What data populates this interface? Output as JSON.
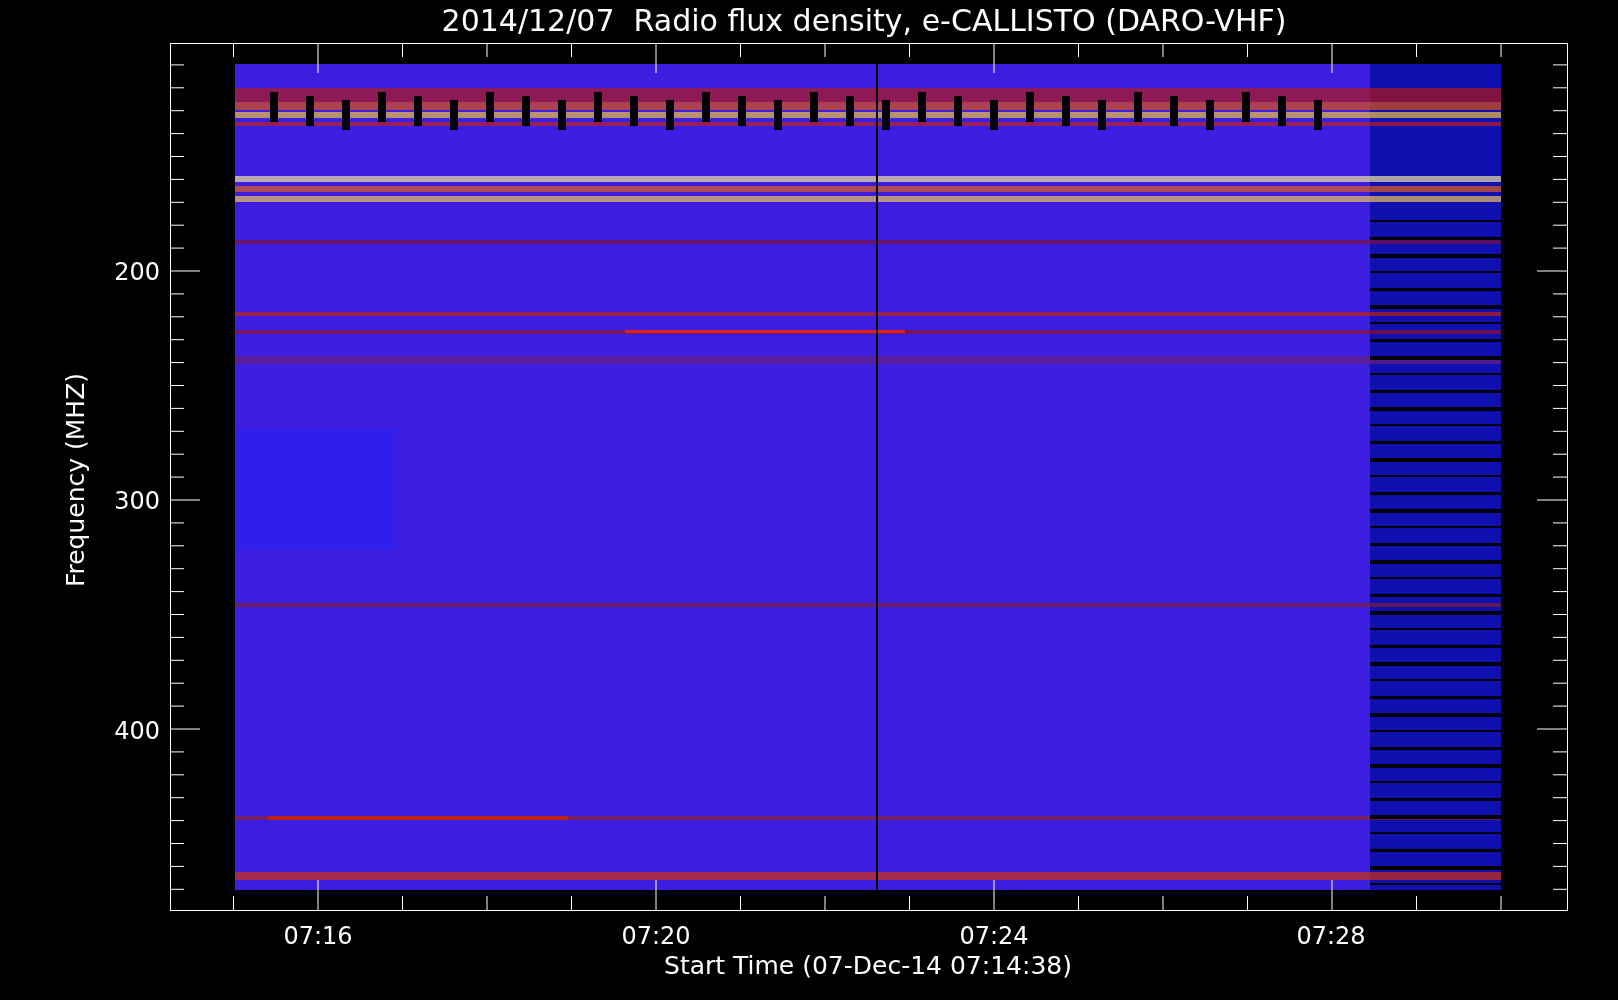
{
  "title": "2014/12/07  Radio flux density, e-CALLISTO (DARO-VHF)",
  "y_axis": {
    "label": "Frequency (MHZ)",
    "ticks": [
      "200",
      "300",
      "400"
    ]
  },
  "x_axis": {
    "label": "Start Time (07-Dec-14 07:14:38)",
    "ticks": [
      "07:16",
      "07:20",
      "07:24",
      "07:28"
    ]
  }
}
